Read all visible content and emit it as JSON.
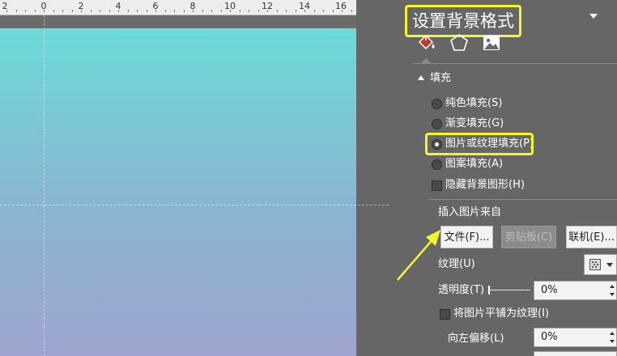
{
  "ruler": {
    "numbers": [
      "2",
      "0",
      "2",
      "4",
      "6",
      "8",
      "10",
      "12",
      "14",
      "16"
    ]
  },
  "panel": {
    "title": "设置背景格式",
    "section_fill": "填充",
    "fill_options": [
      {
        "label": "纯色填充(S)",
        "selected": false
      },
      {
        "label": "渐变填充(G)",
        "selected": false
      },
      {
        "label": "图片或纹理填充(P)",
        "selected": true
      },
      {
        "label": "图案填充(A)",
        "selected": false
      }
    ],
    "hide_bg_graphics": "隐藏背景图形(H)",
    "insert_from": "插入图片来自",
    "file_button": "文件(F)...",
    "clipboard_button": "剪贴板(C)",
    "online_button": "联机(E)...",
    "texture_label": "纹理(U)",
    "transparency_label": "透明度(T)",
    "transparency_value": "0%",
    "transparency_level": 0,
    "tile_label": "将图片平铺为纹理(I)",
    "offset_left_label": "向左偏移(L)",
    "offset_left_value": "0%"
  },
  "colors": {
    "highlight": "#f5f52a",
    "panel_bg": "#666666",
    "slide_top": "#6cdad8",
    "slide_bottom": "#9ea4cf"
  },
  "icons": [
    "fill-bucket-icon",
    "pentagon-effects-icon",
    "picture-icon",
    "dropdown-arrow-icon",
    "texture-picker-icon"
  ]
}
